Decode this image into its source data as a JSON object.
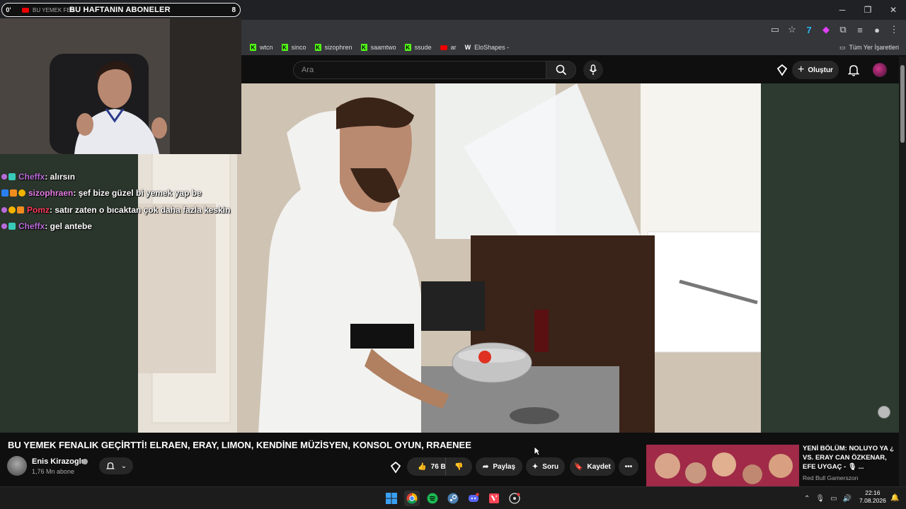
{
  "overlay": {
    "subbar_left": "0'",
    "subbar_ticker": "BU YEMEK FENALIK",
    "subbar_title": "BU HAFTANIN ABONELER",
    "subbar_right": "8"
  },
  "chat": [
    {
      "user": "Cheffx",
      "user_color": "#b96bd9",
      "message": " : alırsın",
      "badges": [
        "purple",
        "teal"
      ]
    },
    {
      "user": "sizophraen",
      "user_color": "#e87ee8",
      "message": " : şef bize güzel bi yemek yap be",
      "badges": [
        "blue",
        "orange",
        "gold"
      ]
    },
    {
      "user": "Pomz",
      "user_color": "#ff3b5c",
      "message": " : satır zaten o bıcaktan çok daha fazla keskin",
      "badges": [
        "purple",
        "gold",
        "orange"
      ]
    },
    {
      "user": "Cheffx",
      "user_color": "#b96bd9",
      "message": " : gel antebe",
      "badges": [
        "purple",
        "teal"
      ]
    }
  ],
  "bookmarks": [
    {
      "label": "wtcn",
      "icon": "kick"
    },
    {
      "label": "sinco",
      "icon": "kick"
    },
    {
      "label": "sizophren",
      "icon": "kick"
    },
    {
      "label": "saamtwo",
      "icon": "kick"
    },
    {
      "label": "ssude",
      "icon": "kick"
    },
    {
      "label": "ar",
      "icon": "youtube"
    },
    {
      "label": "EloShapes -",
      "icon": "w"
    }
  ],
  "all_bookmarks": "Tüm Yer İşaretleri",
  "search": {
    "placeholder": "Ara"
  },
  "header": {
    "create_label": "Oluştur"
  },
  "video": {
    "title": "BU YEMEK FENALIK GEÇİRTTİ! ELRAEN, ERAY, LIMON, KENDİNE MÜZİSYEN, KONSOL OYUN, RRAENEE",
    "channel": "Enis Kirazoglu",
    "subscribers": "1,76 Mn abone",
    "likes": "76 B",
    "share_label": "Paylaş",
    "ask_label": "Soru",
    "save_label": "Kaydet"
  },
  "recommended": {
    "title": "YENİ BÖLÜM: NOLUYO YA ¿ VS. ERAY CAN ÖZKENAR, EFE UYGAÇ - 🎙 ...",
    "channel": "Red Bull Gamerszon"
  },
  "taskbar": {
    "time": "22:16",
    "date": "7.08.2026"
  },
  "colors": {
    "accent_kick": "#53fc18",
    "youtube_red": "#e00000",
    "bg": "#0f0f0f"
  }
}
